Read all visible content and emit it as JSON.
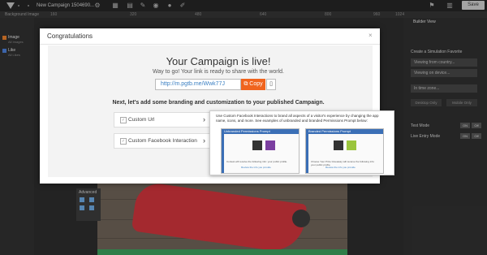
{
  "topbar": {
    "campaign_name": "New Campaign 1504690...",
    "ruler_label": "Background Image",
    "ruler_ticks": [
      "160",
      "320",
      "480",
      "640",
      "800",
      "960",
      "1024"
    ],
    "save_label": "Save"
  },
  "layers": [
    {
      "name": "Image",
      "sub": "All Images"
    },
    {
      "name": "Like",
      "sub": "All Likes"
    }
  ],
  "advanced": {
    "title": "Advanced"
  },
  "right_panel": {
    "title": "Builder View",
    "section": "Create a Simulation Favorite",
    "country_select": "Viewing from country...",
    "device_select": "Viewing on device...",
    "time_select": "In time zone...",
    "desktop_btn": "Desktop Only",
    "mobile_btn": "Mobile Only",
    "test_mode": "Test Mode",
    "live_entry": "Live Entry Mode",
    "toggle_on": "ON",
    "toggle_off": "Off"
  },
  "modal": {
    "title": "Congratulations",
    "close": "×",
    "headline": "Your Campaign is live!",
    "subline": "Way to go! Your link is ready to share with the world.",
    "link": "http://m.pgtb.me/Wwk77J",
    "copy_label": "Copy",
    "copy_icon": "copy-icon",
    "phone_icon": "phone-icon",
    "next_text": "Next, let's add some branding and customization to your published Campaign.",
    "options": [
      {
        "label": "Custom Url",
        "arrow": "›"
      },
      {
        "label": "Custom Facebook Interaction",
        "arrow": "›"
      }
    ]
  },
  "tooltip": {
    "text": "Use Custom Facebook Interactions to brand all aspects of a visitor's experience by changing the app name, icons, and more. See examples of unbranded and branded Permissions Prompt below:",
    "unbranded_title": "Unbranded Permissions Prompt",
    "branded_title": "Branded Permissions Prompt",
    "unbranded_caption": "Contest will receive the following info: your public profile.",
    "branded_caption": "Choose Your Prize Giveaway will receive the following info: your public profile.",
    "review_link": "Review the info you provide"
  },
  "colors": {
    "accent": "#f0641e",
    "link": "#3a7fc2",
    "facebook": "#3b6fb6"
  }
}
